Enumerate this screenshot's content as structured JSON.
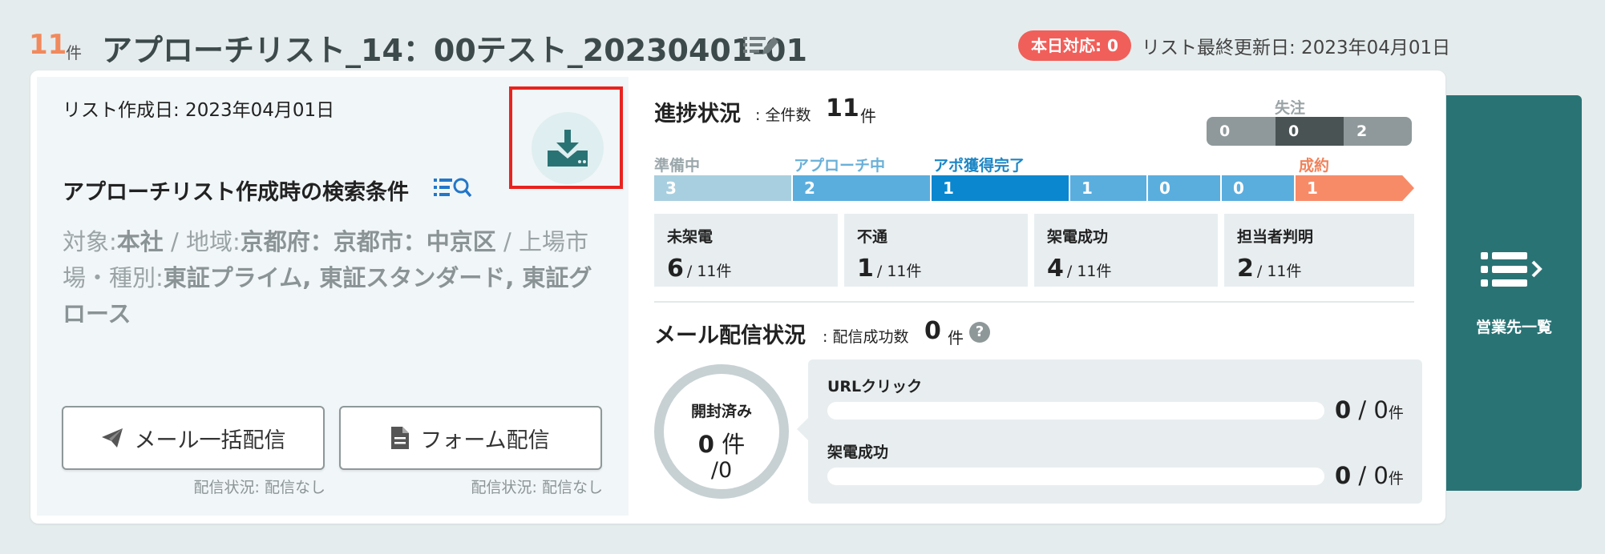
{
  "header": {
    "count": "11",
    "count_unit": "件",
    "title": "アプローチリスト_14：00テスト_20230401-01",
    "today_badge": "本日対応: 0",
    "updated": "リスト最終更新日: 2023年04月01日"
  },
  "left": {
    "created": "リスト作成日: 2023年04月01日",
    "conditions_title": "アプローチリスト作成時の検索条件",
    "conditions": [
      {
        "label": "対象:",
        "value": "本社"
      },
      {
        "label": "地域:",
        "value": "京都府：京都市：中京区"
      },
      {
        "label": "上場市場・種別:",
        "value": "東証プライム, 東証スタンダード, 東証グロース"
      }
    ],
    "mail_button": "メール一括配信",
    "form_button": "フォーム配信",
    "mail_status": "配信状況: 配信なし",
    "form_status": "配信状況: 配信なし"
  },
  "progress": {
    "title": "進捗状況",
    "total_label": ": 全件数",
    "total": "11",
    "total_unit": "件",
    "lost": {
      "label": "失注",
      "segments": [
        {
          "value": "0",
          "color": "#8f999b"
        },
        {
          "value": "0",
          "color": "#4a5354"
        },
        {
          "value": "2",
          "color": "#8f999b"
        }
      ]
    },
    "stages": [
      {
        "label": "準備中",
        "label_color": "#9aa7ab",
        "segments": [
          {
            "value": "3",
            "color": "#a8cfdf"
          }
        ]
      },
      {
        "label": "アプローチ中",
        "label_color": "#6ab0d8",
        "segments": [
          {
            "value": "2",
            "color": "#5aaede"
          }
        ]
      },
      {
        "label": "アポ獲得完了",
        "label_color": "#1d86c5",
        "segments": [
          {
            "value": "1",
            "color": "#0a87cf"
          },
          {
            "value": "1",
            "color": "#5aaede"
          },
          {
            "value": "0",
            "color": "#5aaede"
          },
          {
            "value": "0",
            "color": "#5aaede"
          }
        ]
      },
      {
        "label": "成約",
        "label_color": "#f0825a",
        "segments": [
          {
            "value": "1",
            "color": "#f78b68"
          }
        ]
      }
    ],
    "stats": [
      {
        "label": "未架電",
        "value": "6",
        "total": "/ 11件"
      },
      {
        "label": "不通",
        "value": "1",
        "total": "/ 11件"
      },
      {
        "label": "架電成功",
        "value": "4",
        "total": "/ 11件"
      },
      {
        "label": "担当者判明",
        "value": "2",
        "total": "/ 11件"
      }
    ]
  },
  "mail": {
    "title": "メール配信状況",
    "success_label": ": 配信成功数",
    "success_count": "0",
    "success_unit": "件",
    "help_icon": "?",
    "opened": {
      "label": "開封済み",
      "count": "0",
      "unit": "件",
      "total": "/0"
    },
    "url_click": {
      "label": "URLクリック",
      "value": "0",
      "total": "0",
      "unit": "件"
    },
    "call_success": {
      "label": "架電成功",
      "value": "0",
      "total": "0",
      "unit": "件"
    }
  },
  "sales_list": {
    "label": "営業先一覧",
    "icon": "list-arrow-icon"
  }
}
